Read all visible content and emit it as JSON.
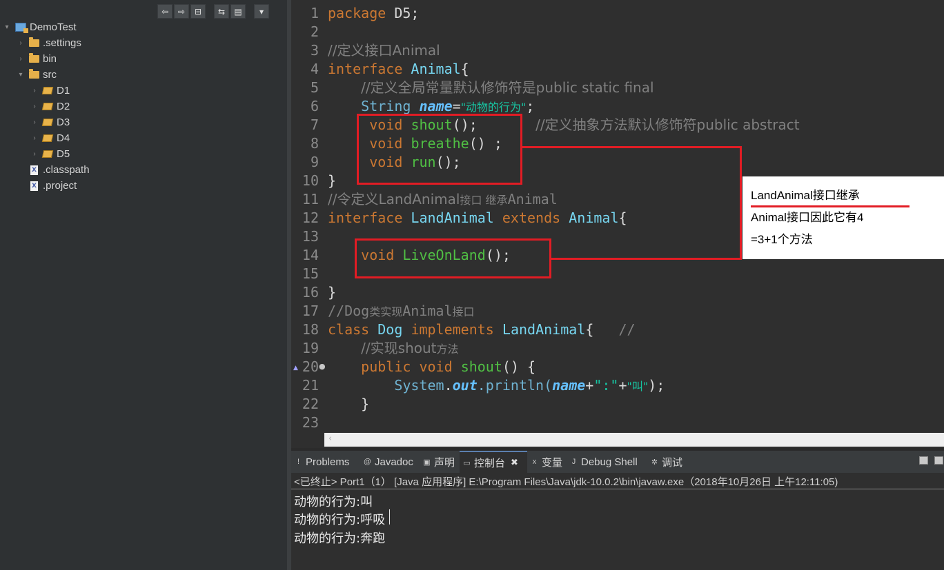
{
  "explorer": {
    "toolbar": [
      {
        "icon": "back-arrow-icon",
        "glyph": "⇦"
      },
      {
        "icon": "forward-arrow-icon",
        "glyph": "⇨"
      },
      {
        "icon": "collapse-all-icon",
        "glyph": "⊟"
      },
      {
        "icon": "link-with-editor-icon",
        "glyph": "⇆"
      },
      {
        "icon": "filter-icon",
        "glyph": "▤"
      },
      {
        "icon": "view-menu-icon",
        "glyph": "▾"
      }
    ],
    "tree": [
      {
        "label": "DemoTest",
        "kind": "project",
        "expanded": true
      },
      {
        "label": ".settings",
        "kind": "folder",
        "expanded": false
      },
      {
        "label": "bin",
        "kind": "folder",
        "expanded": false
      },
      {
        "label": "src",
        "kind": "folder",
        "expanded": true
      },
      {
        "label": "D1",
        "kind": "package",
        "expanded": false
      },
      {
        "label": "D2",
        "kind": "package",
        "expanded": false
      },
      {
        "label": "D3",
        "kind": "package",
        "expanded": false
      },
      {
        "label": "D4",
        "kind": "package",
        "expanded": false
      },
      {
        "label": "D5",
        "kind": "package",
        "expanded": false
      },
      {
        "label": ".classpath",
        "kind": "file"
      },
      {
        "label": ".project",
        "kind": "file"
      }
    ]
  },
  "editor": {
    "line_numbers": [
      "1",
      "2",
      "3",
      "4",
      "5",
      "6",
      "7",
      "8",
      "9",
      "10",
      "11",
      "12",
      "13",
      "14",
      "15",
      "16",
      "17",
      "18",
      "19",
      "20",
      "21",
      "22",
      "23"
    ],
    "code": {
      "l1_kw": "package",
      "l1_rest": " D5;",
      "l3_cm": "//定义接口Animal",
      "l4_kw": "interface",
      "l4_name": "Animal",
      "l4_brace": "{",
      "l5_cm": "//定义全局常量默认修饰符是public static final",
      "l6_type": "String",
      "l6_field": "name",
      "l6_eq": "=",
      "l6_str": "\"动物的行为\"",
      "l6_semi": ";",
      "l7_kw": "void",
      "l7_method": "shout",
      "l7_rest": "();",
      "l7_cm": "//定义抽象方法默认修饰符public abstract",
      "l8_kw": "void",
      "l8_method": "breathe",
      "l8_rest": "() ;",
      "l9_kw": "void",
      "l9_method": "run",
      "l9_rest": "();",
      "l10": "}",
      "l11_cm_a": "//令定义LandAnimal",
      "l11_cm_b": "接口 继承",
      "l11_cm_c": "Animal",
      "l12_kw": "interface",
      "l12_name": "LandAnimal",
      "l12_kw2": "extends",
      "l12_super": "Animal",
      "l12_brace": "{",
      "l14_kw": "void",
      "l14_method": "LiveOnLand",
      "l14_rest": "();",
      "l16": "}",
      "l17_cm_a": "//Dog",
      "l17_cm_b": "类实现",
      "l17_cm_c": "Animal",
      "l17_cm_d": "接口",
      "l18_kw": "class",
      "l18_name": "Dog",
      "l18_kw2": "implements",
      "l18_iface": "LandAnimal",
      "l18_brace": "{",
      "l18_cm": "//",
      "l19_cm_a": "//实现shout",
      "l19_cm_b": "方法",
      "l20_kw": "public",
      "l20_kw2": "void",
      "l20_method": "shout",
      "l20_rest": "() {",
      "l21_type": "System",
      "l21_dot": ".",
      "l21_field": "out",
      "l21_call": ".println(",
      "l21_arg": "name",
      "l21_plus": "+",
      "l21_str1": "\":\"",
      "l21_plus2": "+",
      "l21_str2": "\"叫\"",
      "l21_end": ");",
      "l22": "}"
    },
    "annotation": {
      "line1": "LandAnimal接口继承",
      "line2": "Animal接口因此它有4",
      "line3": "=3+1个方法"
    }
  },
  "console": {
    "tabs": [
      {
        "label": "Problems",
        "icon": "problems-icon",
        "glyph": "!"
      },
      {
        "label": "Javadoc",
        "icon": "javadoc-icon",
        "glyph": "@"
      },
      {
        "label": "声明",
        "icon": "declaration-icon",
        "glyph": "▣"
      },
      {
        "label": "控制台",
        "icon": "console-icon",
        "glyph": "▭",
        "active": true
      },
      {
        "label": "变量",
        "icon": "variables-icon",
        "glyph": "x"
      },
      {
        "label": "Debug Shell",
        "icon": "debug-shell-icon",
        "glyph": "J"
      },
      {
        "label": "调试",
        "icon": "debug-icon",
        "glyph": "✲"
      }
    ],
    "header": "<已终止> Port1（1） [Java 应用程序] E:\\Program Files\\Java\\jdk-10.0.2\\bin\\javaw.exe（2018年10月26日 上午12:11:05)",
    "output": [
      "动物的行为:叫",
      "动物的行为:呼吸",
      "动物的行为:奔跑"
    ]
  },
  "colors": {
    "annotation_red": "#e21c24",
    "keyword": "#cc7832",
    "method": "#50c044",
    "comment": "#808080"
  }
}
